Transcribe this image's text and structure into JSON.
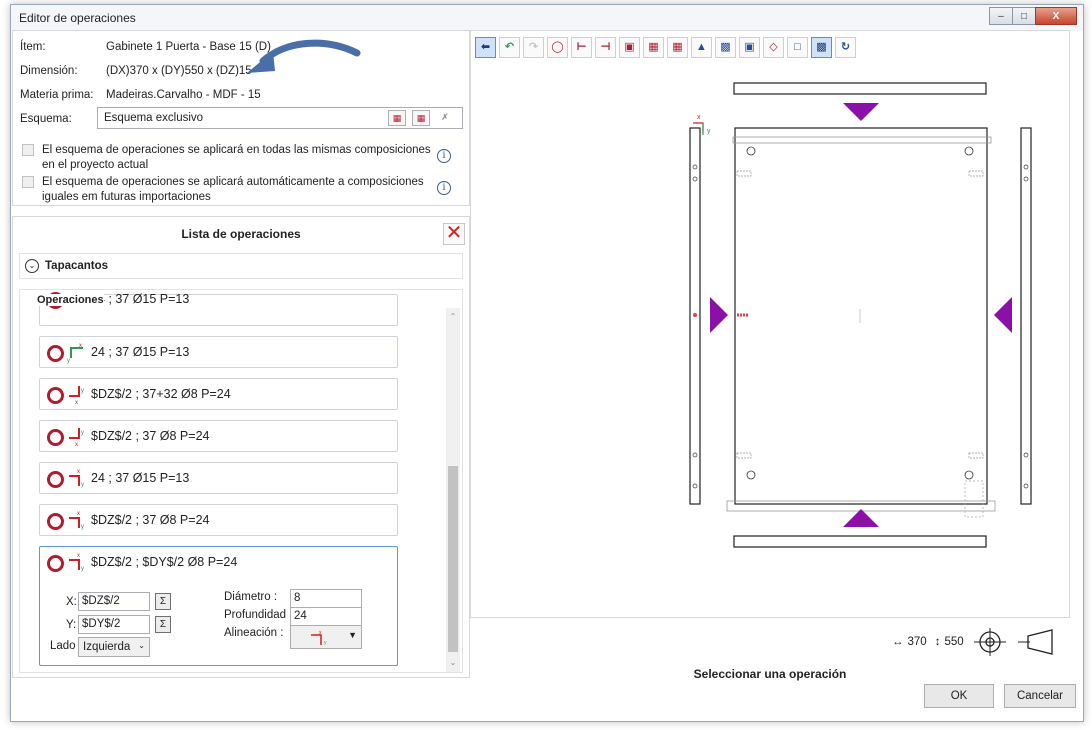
{
  "window": {
    "title": "Editor de operaciones",
    "min": "–",
    "max": "□",
    "close": "X"
  },
  "info": {
    "item_label": "Ítem:",
    "item_value": "Gabinete 1 Puerta - Base 15  (D)",
    "dim_label": "Dimensión:",
    "dim_value": "(DX)370 x (DY)550 x (DZ)15",
    "mat_label": "Materia prima:",
    "mat_value": "Madeiras.Carvalho - MDF - 15",
    "schema_label": "Esquema:",
    "schema_value": "Esquema exclusivo",
    "check1": "El esquema de operaciones se aplicará en todas las mismas composiciones en el proyecto actual",
    "check2": "El esquema de operaciones se aplicará automáticamente a composiciones iguales em futuras importaciones",
    "info_glyph": "i"
  },
  "oplist": {
    "title": "Lista de operaciones",
    "close": "✕",
    "tapacantos": "Tapacantos",
    "section": "Operaciones",
    "items": [
      {
        "label": "24 ; 37 Ø15 P=13"
      },
      {
        "label": "24 ; 37 Ø15 P=13"
      },
      {
        "label": "$DZ$/2 ; 37+32 Ø8 P=24"
      },
      {
        "label": "$DZ$/2 ; 37 Ø8 P=24"
      },
      {
        "label": "24 ; 37 Ø15 P=13"
      },
      {
        "label": "$DZ$/2 ; 37 Ø8 P=24"
      },
      {
        "label": "$DZ$/2 ; $DY$/2 Ø8 P=24"
      }
    ],
    "form": {
      "x_label": "X:",
      "x_value": "$DZ$/2",
      "y_label": "Y:",
      "y_value": "$DY$/2",
      "lado_label": "Lado :",
      "lado_value": "Izquierda",
      "diam_label": "Diámetro :",
      "diam_value": "8",
      "prof_label": "Profundidad :",
      "prof_value": "24",
      "alin_label": "Alineación :",
      "formula_glyph": "Σ"
    }
  },
  "toolbar": [
    "pointer-icon",
    "undo-icon",
    "redo-icon",
    "add-hole-icon",
    "add-side-hole-icon",
    "add-groove-icon",
    "add-cut-icon",
    "pattern-icon",
    "pattern-alt-icon",
    "mirror-icon",
    "frame-add-icon",
    "frame-remove-icon",
    "ruler-icon",
    "panel-outline-icon",
    "panel-fill-icon",
    "rotate-icon"
  ],
  "canvas_footer": {
    "dx": "370",
    "dy": "550"
  },
  "status": "Seleccionar una operación",
  "buttons": {
    "ok": "OK",
    "cancel": "Cancelar"
  },
  "colors": {
    "accent": "#b01c2e",
    "arrow": "#8a10a8",
    "select": "#5b9bd5"
  }
}
